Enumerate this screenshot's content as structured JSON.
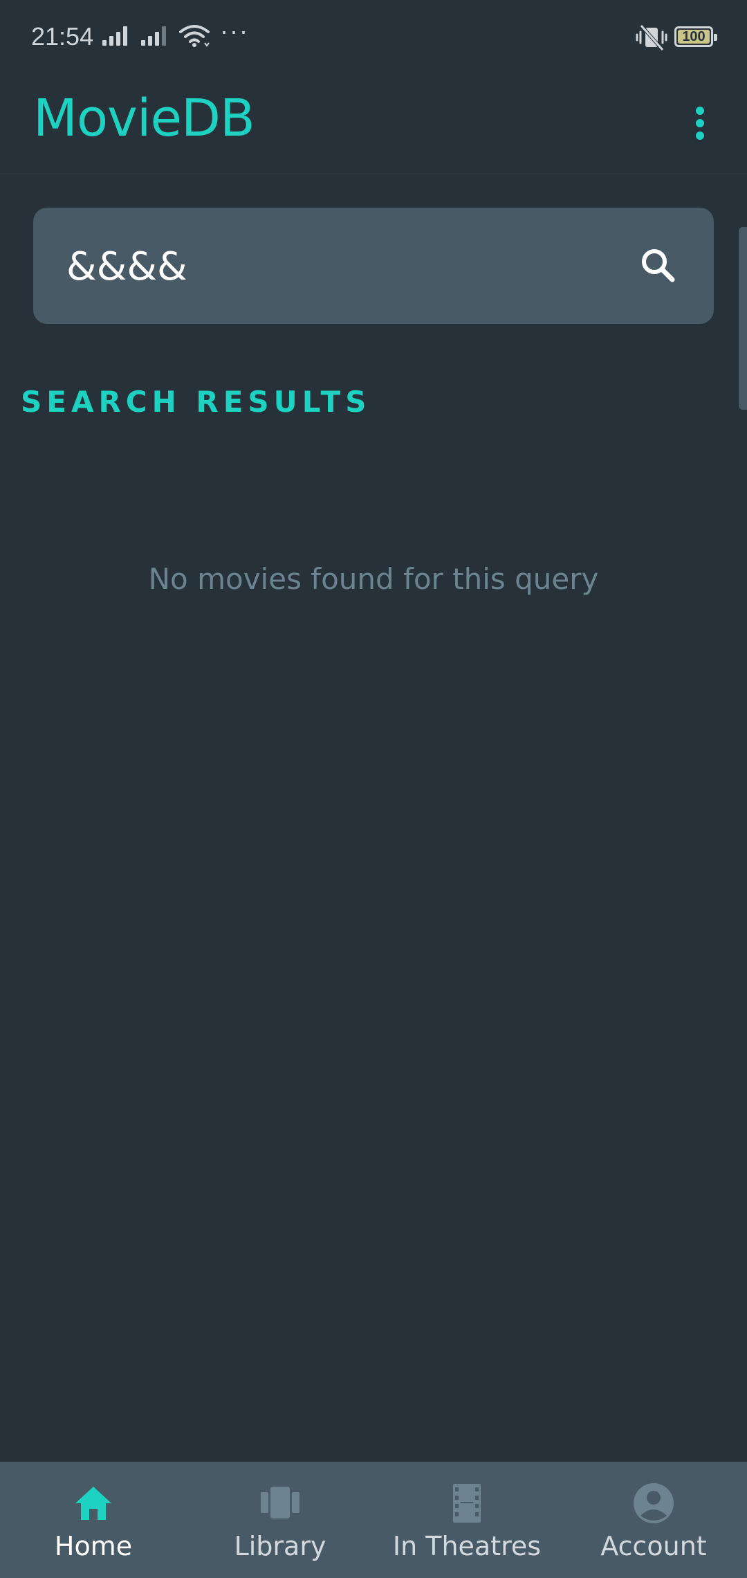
{
  "status_bar": {
    "time": "21:54",
    "battery": "100",
    "icons": [
      "signal-icon",
      "signal-icon",
      "wifi-icon",
      "more-dots-icon",
      "vibrate-icon",
      "battery-icon"
    ]
  },
  "app_bar": {
    "title": "MovieDB",
    "menu_icon": "more-vert-icon"
  },
  "search": {
    "value": "&&&&",
    "icon": "search-icon"
  },
  "results": {
    "heading": "SEARCH RESULTS",
    "empty_message": "No movies found for this query"
  },
  "bottom_nav": {
    "items": [
      {
        "label": "Home",
        "icon": "home-icon",
        "active": true
      },
      {
        "label": "Library",
        "icon": "library-icon",
        "active": false
      },
      {
        "label": "In Theatres",
        "icon": "film-icon",
        "active": false
      },
      {
        "label": "Account",
        "icon": "account-icon",
        "active": false
      }
    ]
  },
  "colors": {
    "background": "#263139",
    "accent": "#1ed2c2",
    "surface": "#475a66",
    "muted_text": "#6d8490",
    "inactive_icon": "#6d8490"
  }
}
